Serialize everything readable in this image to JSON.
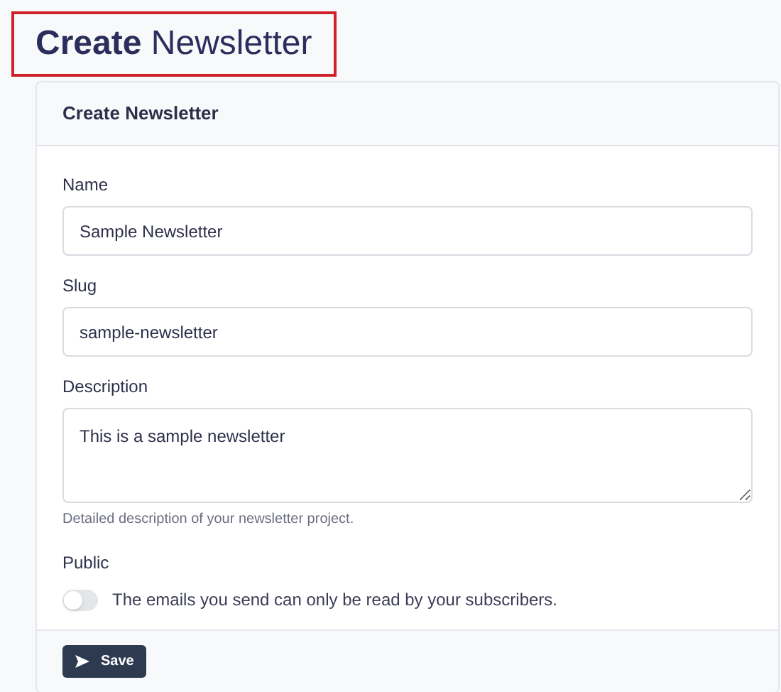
{
  "page_title": "**Create** Newsletter",
  "card": {
    "title": "Create Newsletter",
    "fields": [
      {
        "kind": "text",
        "label": "Name",
        "value": "Sample Newsletter"
      },
      {
        "kind": "text",
        "label": "Slug",
        "value": "sample-newsletter"
      },
      {
        "kind": "textarea",
        "label": "Description",
        "value": "This is a sample newsletter",
        "help": "Detailed description of your newsletter project."
      },
      {
        "kind": "toggle",
        "label": "Public",
        "on": false,
        "description": "The emails you send can only be read by your subscribers."
      }
    ],
    "save_button": "Save"
  }
}
